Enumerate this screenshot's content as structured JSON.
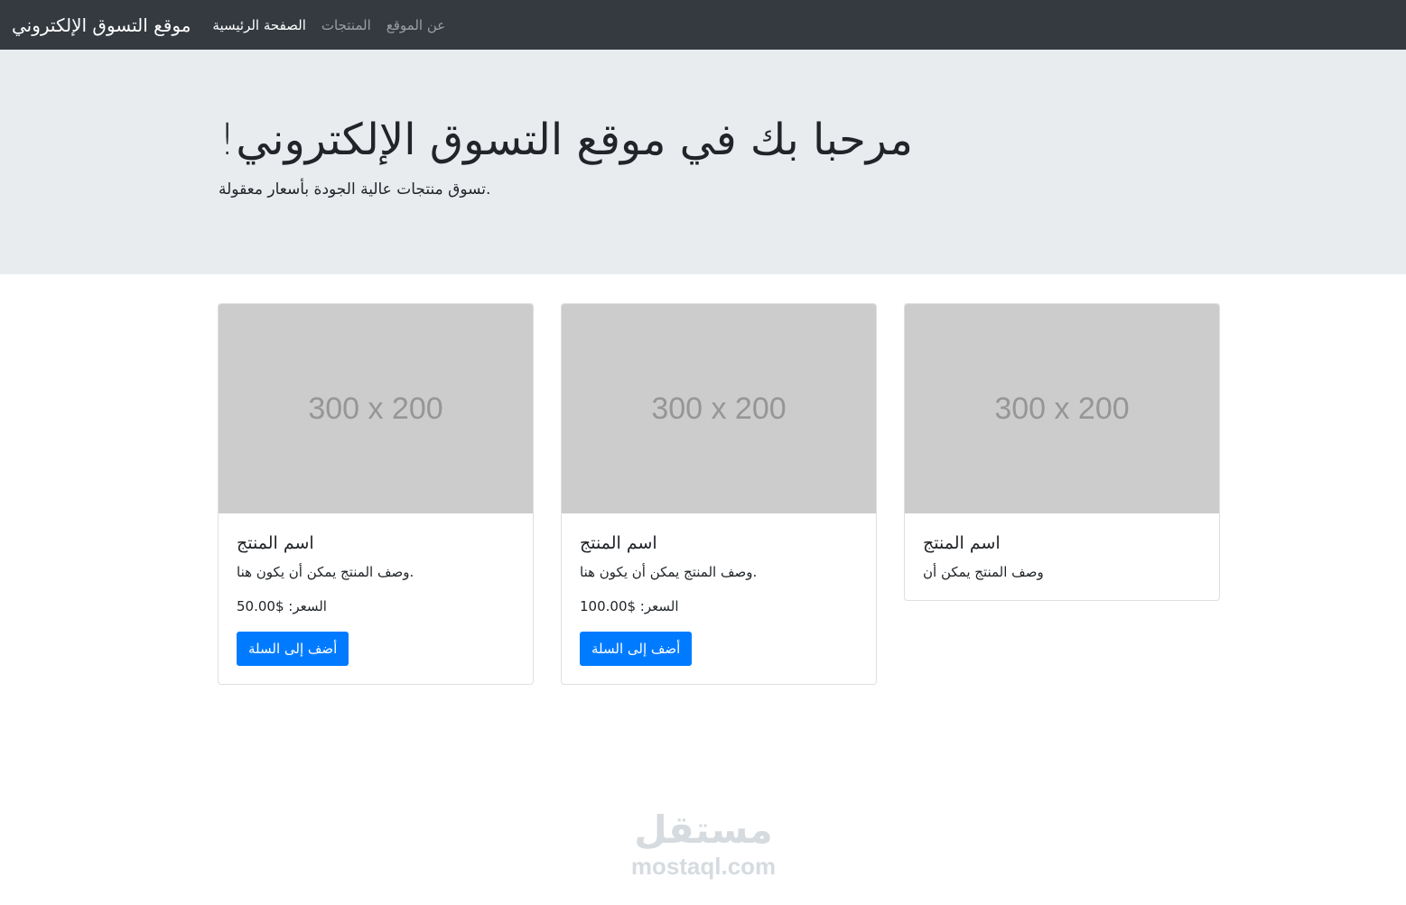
{
  "navbar": {
    "brand": "موقع التسوق الإلكتروني",
    "links": [
      {
        "label": "الصفحة الرئيسية",
        "active": true
      },
      {
        "label": "المنتجات",
        "active": false
      },
      {
        "label": "عن الموقع",
        "active": false
      }
    ]
  },
  "hero": {
    "title": "مرحبا بك في موقع التسوق الإلكتروني!",
    "subtitle": "تسوق منتجات عالية الجودة بأسعار معقولة."
  },
  "products": [
    {
      "image_label": "300 x 200",
      "name": "اسم المنتج",
      "description": "وصف المنتج يمكن أن يكون هنا.",
      "price": "السعر: $50.00",
      "button_label": "أضف إلى السلة"
    },
    {
      "image_label": "300 x 200",
      "name": "اسم المنتج",
      "description": "وصف المنتج يمكن أن يكون هنا.",
      "price": "السعر: $100.00",
      "button_label": "أضف إلى السلة"
    },
    {
      "image_label": "300 x 200",
      "name": "اسم المنتج",
      "description": "وصف المنتج يمكن أن"
    }
  ],
  "watermark": {
    "logo_text": "مستقل",
    "url": "mostaql.com"
  },
  "colors": {
    "navbar_bg": "#343a40",
    "hero_bg": "#e9ecef",
    "primary_button": "#007bff",
    "placeholder_bg": "#cccccc"
  }
}
